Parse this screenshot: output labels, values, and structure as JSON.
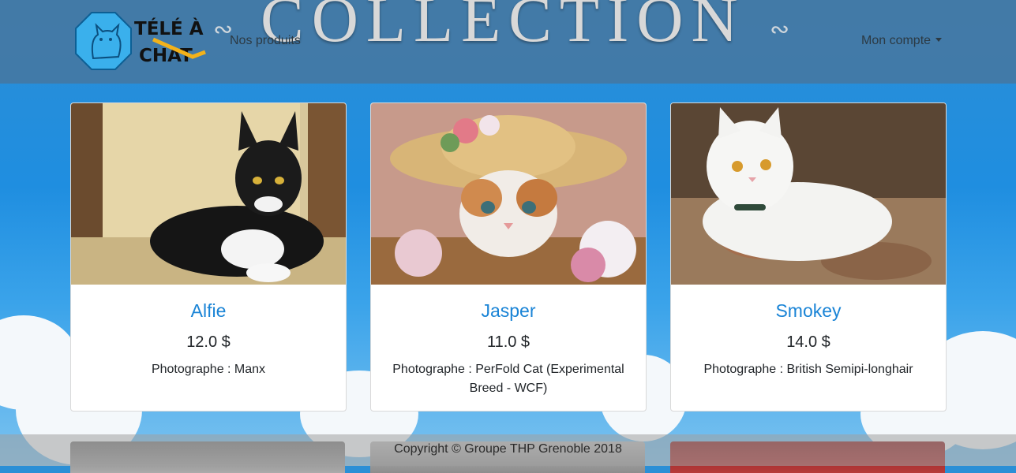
{
  "header": {
    "banner_text": "COLLECTION",
    "logo_text_line1": "TÉLÉ À",
    "logo_text_line2": "CHAT",
    "nav_products": "Nos produits",
    "nav_account": "Mon compte"
  },
  "products": [
    {
      "name": "Alfie",
      "price": "12.0 $",
      "description": "Photographe : Manx"
    },
    {
      "name": "Jasper",
      "price": "11.0 $",
      "description": "Photographe : PerFold Cat (Experimental Breed - WCF)"
    },
    {
      "name": "Smokey",
      "price": "14.0 $",
      "description": "Photographe : British Semipi-longhair"
    }
  ],
  "footer": {
    "copyright": "Copyright © Groupe THP Grenoble 2018"
  },
  "colors": {
    "link": "#1a84d6",
    "navbar": "#46789f",
    "sky": "#1f8ee0"
  }
}
